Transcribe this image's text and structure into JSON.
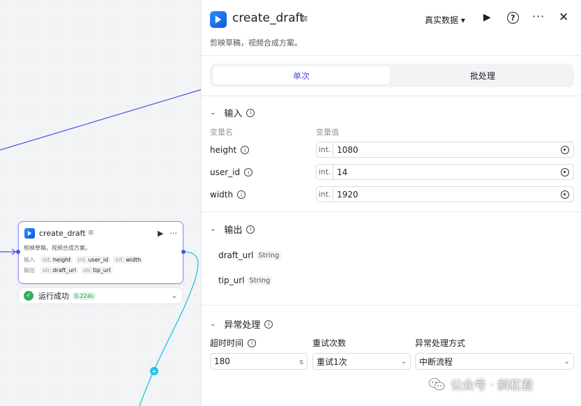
{
  "node": {
    "title": "create_draft",
    "tag": "⊠",
    "desc": "剪映草稿，视频合成方案。",
    "input_label": "输入",
    "output_label": "输出",
    "inputs": [
      {
        "type": "int.",
        "name": "height"
      },
      {
        "type": "int.",
        "name": "user_id"
      },
      {
        "type": "int.",
        "name": "width"
      }
    ],
    "outputs": [
      {
        "type": "str.",
        "name": "draft_url"
      },
      {
        "type": "str.",
        "name": "tip_url"
      }
    ],
    "run_glyph": "▶",
    "more_glyph": "···"
  },
  "run_status": {
    "text": "运行成功",
    "time": "0.224s",
    "icon": "check-icon"
  },
  "panel": {
    "title": "create_draft",
    "desc": "剪映草稿，视频合成方案。",
    "data_select": "真实数据",
    "tabs": [
      "单次",
      "批处理"
    ],
    "input_section": "输入",
    "col_name": "变量名",
    "col_value": "变量值",
    "variables": [
      {
        "name": "height",
        "type": "int.",
        "value": "1080"
      },
      {
        "name": "user_id",
        "type": "int.",
        "value": "14"
      },
      {
        "name": "width",
        "type": "int.",
        "value": "1920"
      }
    ],
    "output_section": "输出",
    "outputs": [
      {
        "name": "draft_url",
        "type": "String"
      },
      {
        "name": "tip_url",
        "type": "String"
      }
    ],
    "error_section": "异常处理",
    "timeout_label": "超时时间",
    "timeout_value": "180",
    "timeout_unit": "s",
    "retry_label": "重试次数",
    "retry_value": "重试1次",
    "error_mode_label": "异常处理方式",
    "error_mode_value": "中断流程"
  },
  "watermark": "公众号 · 斜杠君",
  "colors": {
    "accent": "#4d53e8",
    "edge_blue": "#4d53e8",
    "edge_cyan": "#22c3e6",
    "success": "#2fb05a"
  }
}
